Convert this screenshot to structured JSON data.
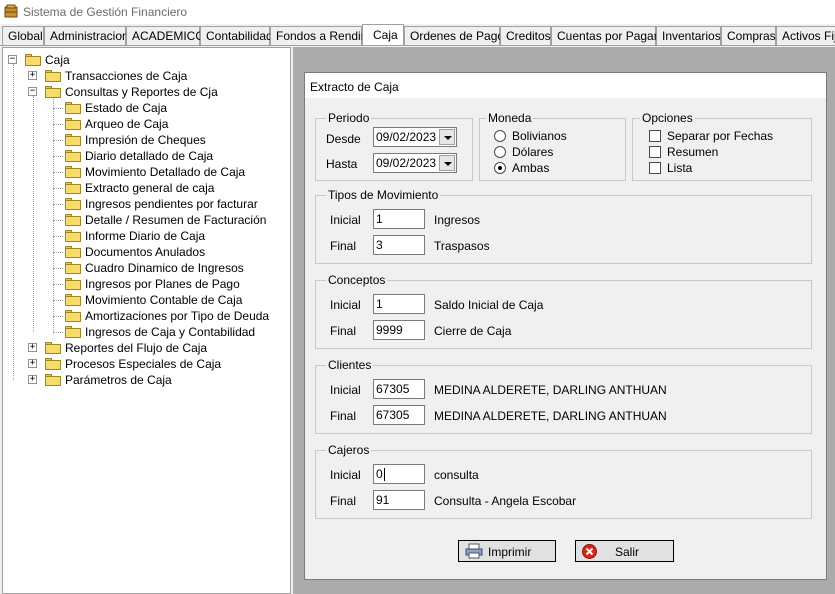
{
  "window": {
    "title": "Sistema de Gestión Financiero"
  },
  "tabs": [
    "Global",
    "Administracion",
    "ACADEMICO",
    "Contabilidad",
    "Fondos a Rendir",
    "Caja",
    "Ordenes de Pago",
    "Creditos",
    "Cuentas por Pagar",
    "Inventarios",
    "Compras",
    "Activos Fijo"
  ],
  "active_tab": "Caja",
  "tree": {
    "root": "Caja",
    "nodes": {
      "transacciones": "Transacciones de Caja",
      "consultas": "Consultas y Reportes de Cja",
      "items": [
        "Estado de Caja",
        "Arqueo de Caja",
        "Impresión de Cheques",
        "Diario detallado de Caja",
        "Movimiento Detallado de Caja",
        "Extracto general de caja",
        "Ingresos pendientes por facturar",
        "Detalle / Resumen de Facturación",
        "Informe Diario de Caja",
        "Documentos Anulados",
        "Cuadro Dinamico de Ingresos",
        "Ingresos por Planes de Pago",
        "Movimiento Contable de Caja",
        "Amortizaciones por Tipo de Deuda",
        "Ingresos de Caja y Contabilidad"
      ],
      "reportes_flujo": "Reportes del Flujo de Caja",
      "procesos": "Procesos Especiales de Caja",
      "parametros": "Parámetros de Caja"
    }
  },
  "dialog": {
    "title": "Extracto de Caja",
    "periodo": {
      "legend": "Periodo",
      "desde_label": "Desde",
      "desde_value": "09/02/2023",
      "hasta_label": "Hasta",
      "hasta_value": "09/02/2023"
    },
    "moneda": {
      "legend": "Moneda",
      "options": [
        "Bolivianos",
        "Dólares",
        "Ambas"
      ],
      "selected": "Ambas"
    },
    "opciones": {
      "legend": "Opciones",
      "options": [
        "Separar por Fechas",
        "Resumen",
        "Lista"
      ]
    },
    "tipos": {
      "legend": "Tipos de Movimiento",
      "inicial_label": "Inicial",
      "inicial_value": "1",
      "inicial_desc": "Ingresos",
      "final_label": "Final",
      "final_value": "3",
      "final_desc": "Traspasos"
    },
    "conceptos": {
      "legend": "Conceptos",
      "inicial_label": "Inicial",
      "inicial_value": "1",
      "inicial_desc": "Saldo Inicial de Caja",
      "final_label": "Final",
      "final_value": "9999",
      "final_desc": "Cierre de Caja"
    },
    "clientes": {
      "legend": "Clientes",
      "inicial_label": "Inicial",
      "inicial_value": "67305",
      "inicial_desc": "MEDINA ALDERETE, DARLING ANTHUAN",
      "final_label": "Final",
      "final_value": "67305",
      "final_desc": "MEDINA ALDERETE, DARLING ANTHUAN"
    },
    "cajeros": {
      "legend": "Cajeros",
      "inicial_label": "Inicial",
      "inicial_value": "0",
      "inicial_desc": "consulta",
      "final_label": "Final",
      "final_value": "91",
      "final_desc": "Consulta - Angela Escobar"
    },
    "buttons": {
      "print": "Imprimir",
      "exit": "Salir"
    }
  },
  "colors": {
    "mdi_background": "#ababab",
    "folder": "#f6dc6a",
    "exit_icon": "#d9261c"
  }
}
